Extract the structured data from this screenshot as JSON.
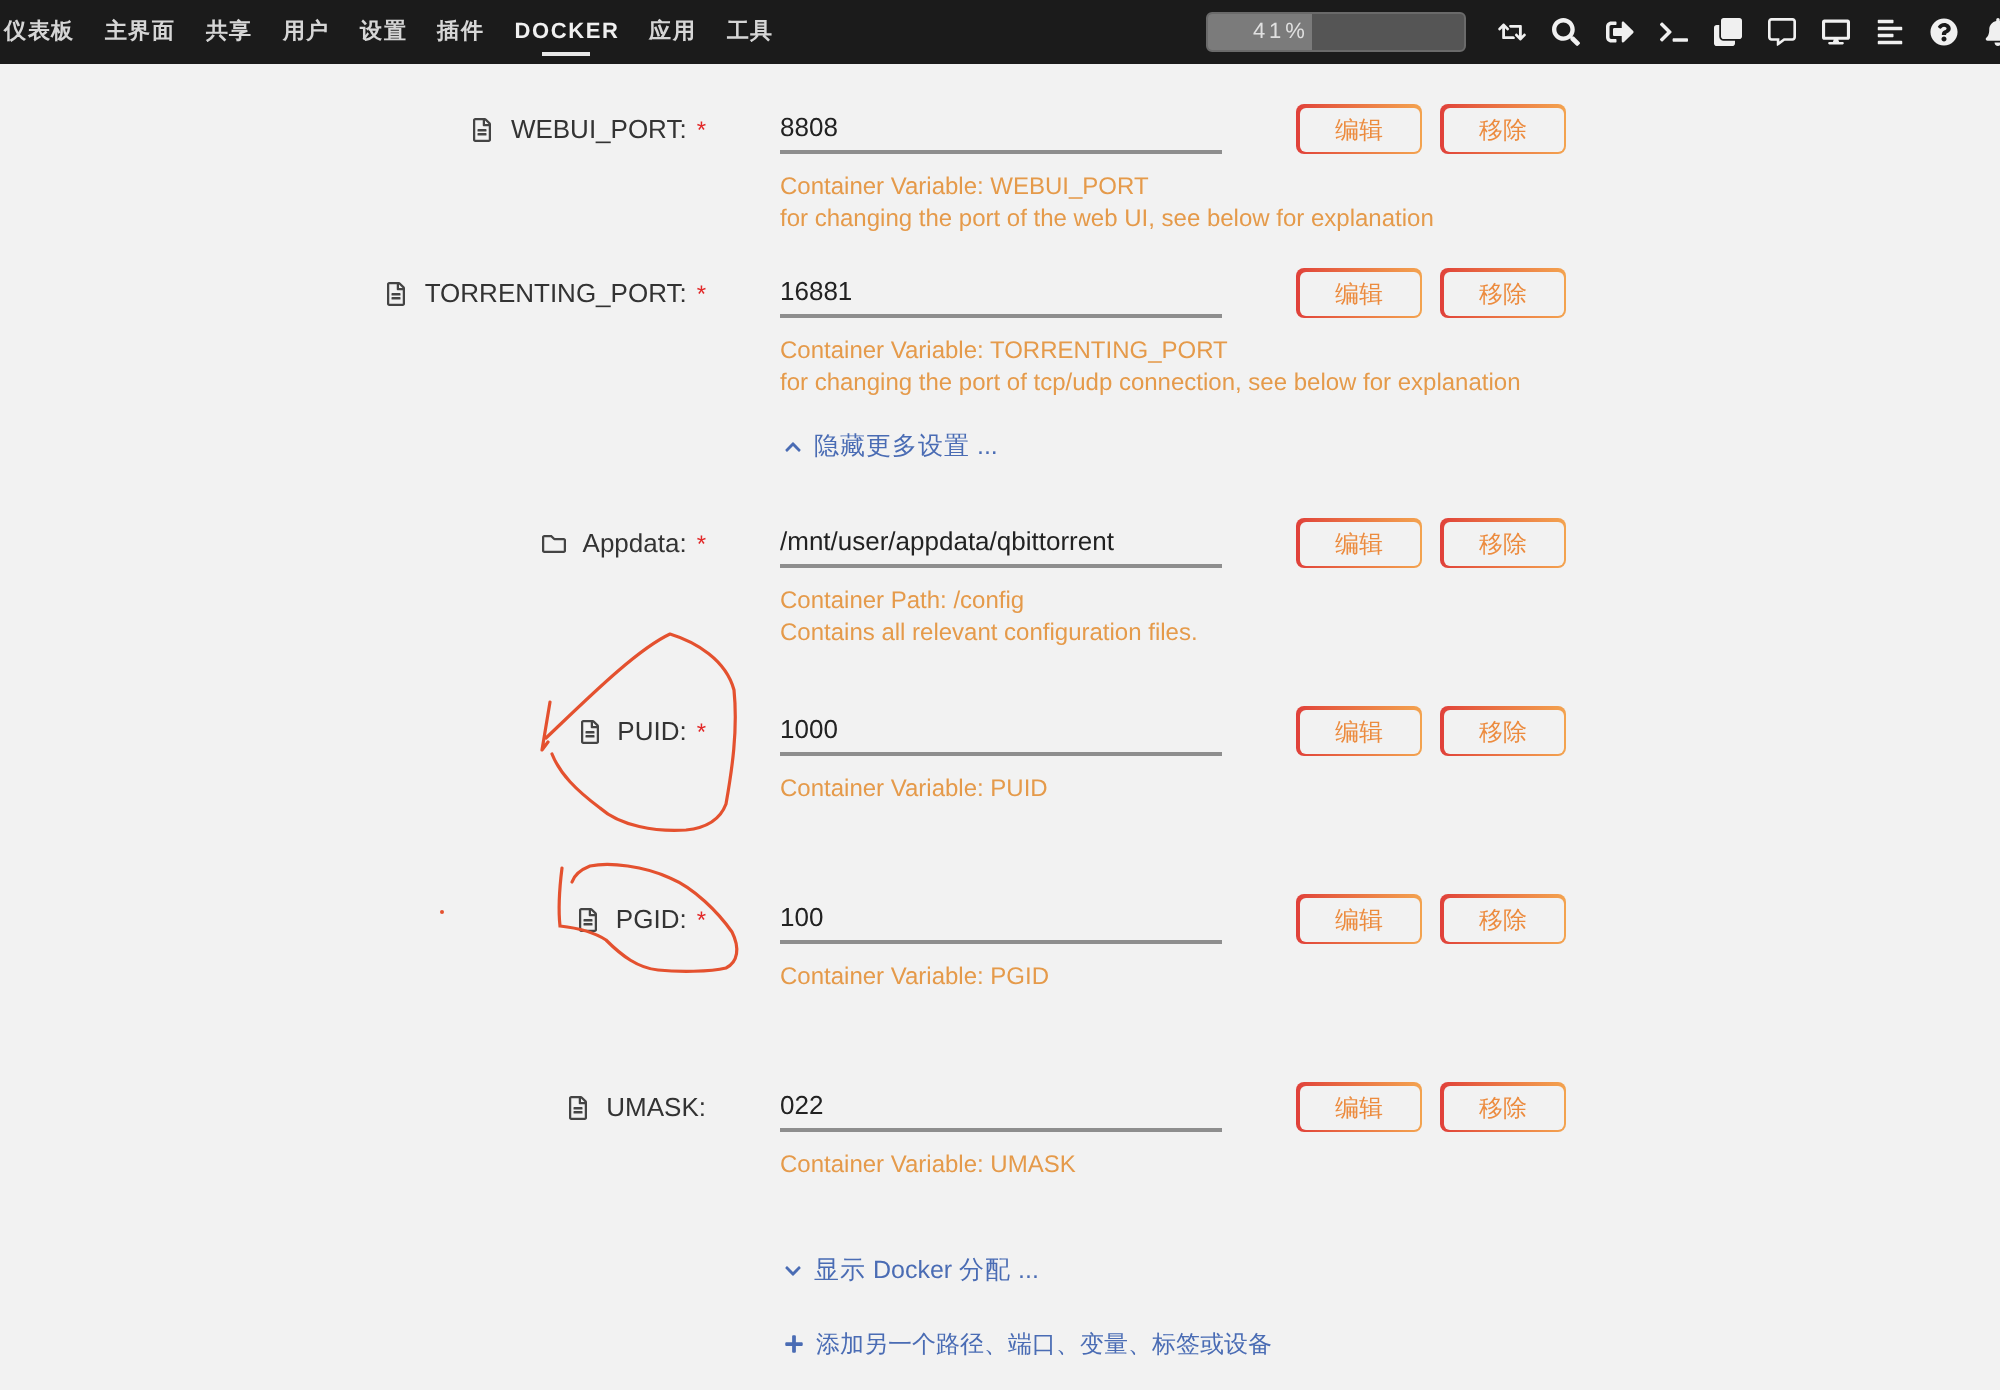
{
  "nav": {
    "tabs": [
      {
        "label": "仪表板",
        "selected": false
      },
      {
        "label": "主界面",
        "selected": false
      },
      {
        "label": "共享",
        "selected": false
      },
      {
        "label": "用户",
        "selected": false
      },
      {
        "label": "设置",
        "selected": false
      },
      {
        "label": "插件",
        "selected": false
      },
      {
        "label": "DOCKER",
        "selected": true
      },
      {
        "label": "应用",
        "selected": false
      },
      {
        "label": "工具",
        "selected": false
      }
    ]
  },
  "progress": {
    "level": 0.41,
    "text": "41%"
  },
  "sections": [
    {
      "rows": [
        {
          "kind": "variable",
          "label": "WEBUI_PORT:",
          "required_mark": "*",
          "value": "8808",
          "description": [
            "Container Variable: WEBUI_PORT",
            "for changing the port of the web UI, see below for explanation"
          ],
          "buttons": [
            "编辑",
            "移除"
          ]
        },
        {
          "kind": "variable",
          "label": "TORRENTING_PORT:",
          "required_mark": "*",
          "value": "16881",
          "description": [
            "Container Variable: TORRENTING_PORT",
            "for changing the port of tcp/udp connection, see below for explanation"
          ],
          "buttons": [
            "编辑",
            "移除"
          ]
        }
      ],
      "toggle": {
        "label": "隐藏更多设置 ...",
        "expanded": true
      }
    },
    {
      "rows": [
        {
          "kind": "path",
          "label": "Appdata:",
          "required_mark": "*",
          "value": "/mnt/user/appdata/qbittorrent",
          "description": [
            "Container Path: /config",
            "Contains all relevant configuration files."
          ],
          "buttons": [
            "编辑",
            "移除"
          ]
        },
        {
          "kind": "variable",
          "label": "PUID:",
          "required_mark": "*",
          "value": "1000",
          "description": [
            "Container Variable: PUID"
          ],
          "buttons": [
            "编辑",
            "移除"
          ],
          "circled": true
        },
        {
          "kind": "variable",
          "label": "PGID:",
          "required_mark": "*",
          "value": "100",
          "description": [
            "Container Variable: PGID"
          ],
          "buttons": [
            "编辑",
            "移除"
          ],
          "circled": true,
          "ink_dot": true
        },
        {
          "kind": "variable",
          "label": "UMASK:",
          "value": "022",
          "description": [
            "Container Variable: UMASK"
          ],
          "buttons": [
            "编辑",
            "移除"
          ]
        }
      ],
      "toggle": {
        "label": "显示 Docker 分配 ...",
        "expanded": false
      }
    }
  ],
  "add_link": {
    "label": "添加另一个路径、端口、变量、标签或设备"
  }
}
